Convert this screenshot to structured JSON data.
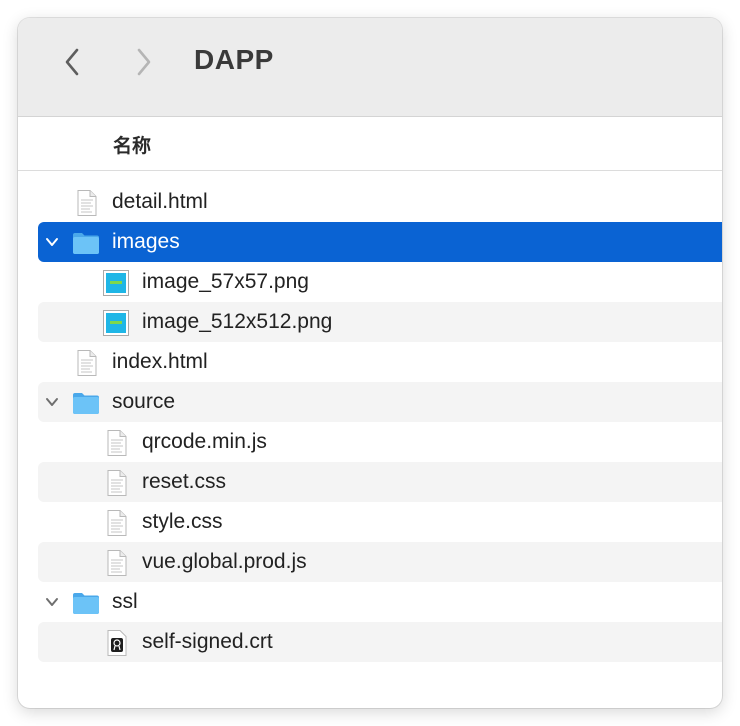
{
  "window": {
    "title": "DAPP"
  },
  "toolbar": {
    "back_icon": "chevron-left-icon",
    "forward_icon": "chevron-right-icon"
  },
  "columns": {
    "name": "名称"
  },
  "colors": {
    "selection": "#0a63d3",
    "folder": "#59b4f2",
    "toolbar_bg": "#ececec"
  },
  "files": [
    {
      "name": "detail.html",
      "type": "document",
      "level": 0
    },
    {
      "name": "images",
      "type": "folder",
      "level": 0,
      "expanded": true,
      "selected": true
    },
    {
      "name": "image_57x57.png",
      "type": "image",
      "level": 1
    },
    {
      "name": "image_512x512.png",
      "type": "image",
      "level": 1
    },
    {
      "name": "index.html",
      "type": "document",
      "level": 0
    },
    {
      "name": "source",
      "type": "folder",
      "level": 0,
      "expanded": true
    },
    {
      "name": "qrcode.min.js",
      "type": "document",
      "level": 1
    },
    {
      "name": "reset.css",
      "type": "document",
      "level": 1
    },
    {
      "name": "style.css",
      "type": "document",
      "level": 1
    },
    {
      "name": "vue.global.prod.js",
      "type": "document",
      "level": 1
    },
    {
      "name": "ssl",
      "type": "folder",
      "level": 0,
      "expanded": true
    },
    {
      "name": "self-signed.crt",
      "type": "certificate",
      "level": 1
    }
  ]
}
